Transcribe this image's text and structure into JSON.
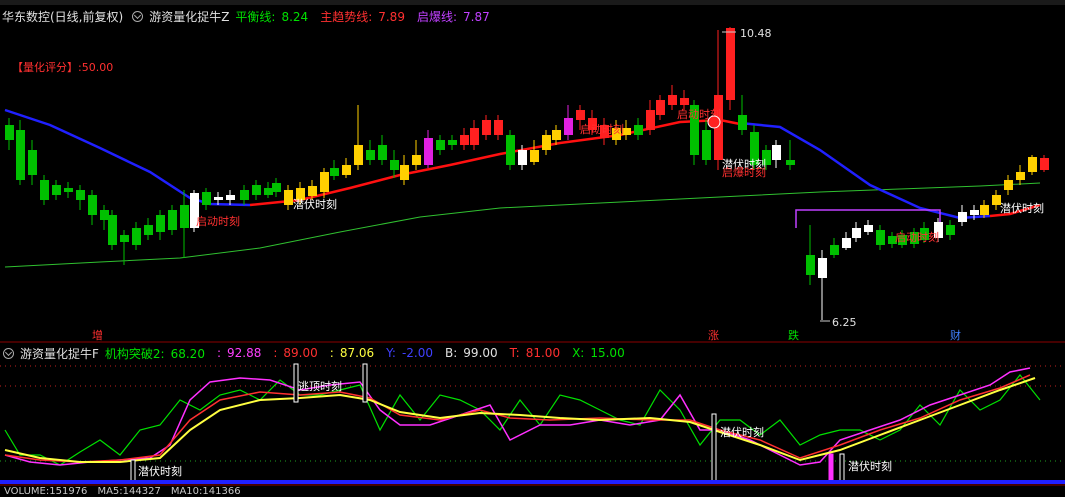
{
  "main": {
    "stock_name": "华东数控(日线,前复权)",
    "indicator_name": "游资量化捉牛Z",
    "lines": [
      {
        "label": "平衡线:",
        "value": "8.24",
        "color": "#00e000"
      },
      {
        "label": "主趋势线:",
        "value": "7.89",
        "color": "#ff3030"
      },
      {
        "label": "启爆线:",
        "value": "7.87",
        "color": "#c040ff"
      }
    ],
    "score_label": "【量化评分】:50.00",
    "high_label": "10.48",
    "low_label": "6.25",
    "signals": [
      "启动时刻",
      "潜伏时刻",
      "启动时刻",
      "启动时刻",
      "潜伏时刻",
      "启爆时刻",
      "启动时刻",
      "潜伏时刻"
    ],
    "bottom_marks": [
      "增",
      "涨",
      "跌",
      "财"
    ]
  },
  "sub": {
    "indicator_name": "游资量化捉牛F",
    "params": [
      {
        "label": "机构突破2:",
        "value": "68.20",
        "color": "#00e000"
      },
      {
        "label": ":",
        "value": "92.88",
        "color": "#ff40ff"
      },
      {
        "label": ":",
        "value": "89.00",
        "color": "#ff3030"
      },
      {
        "label": ":",
        "value": "87.06",
        "color": "#ffff40"
      },
      {
        "label": "Y:",
        "value": "-2.00",
        "color": "#4040ff"
      },
      {
        "label": "B:",
        "value": "99.00",
        "color": "#e0e0e0"
      },
      {
        "label": "T:",
        "value": "81.00",
        "color": "#ff3030"
      },
      {
        "label": "X:",
        "value": "15.00",
        "color": "#00e000"
      }
    ],
    "signals": [
      "潜伏时刻",
      "逃顶时刻",
      "潜伏时刻",
      "潜伏时刻"
    ]
  },
  "volume": {
    "label": "VOLUME:",
    "value": "151976",
    "ma5_label": "MA5:",
    "ma5": "144327",
    "ma10_label": "MA10:",
    "ma10": "141366"
  },
  "colors": {
    "up": "#ff2020",
    "down": "#00c000",
    "blue": "#2020ff",
    "ma": "#30c030",
    "purple": "#c040ff",
    "yellow": "#ffd000"
  }
}
